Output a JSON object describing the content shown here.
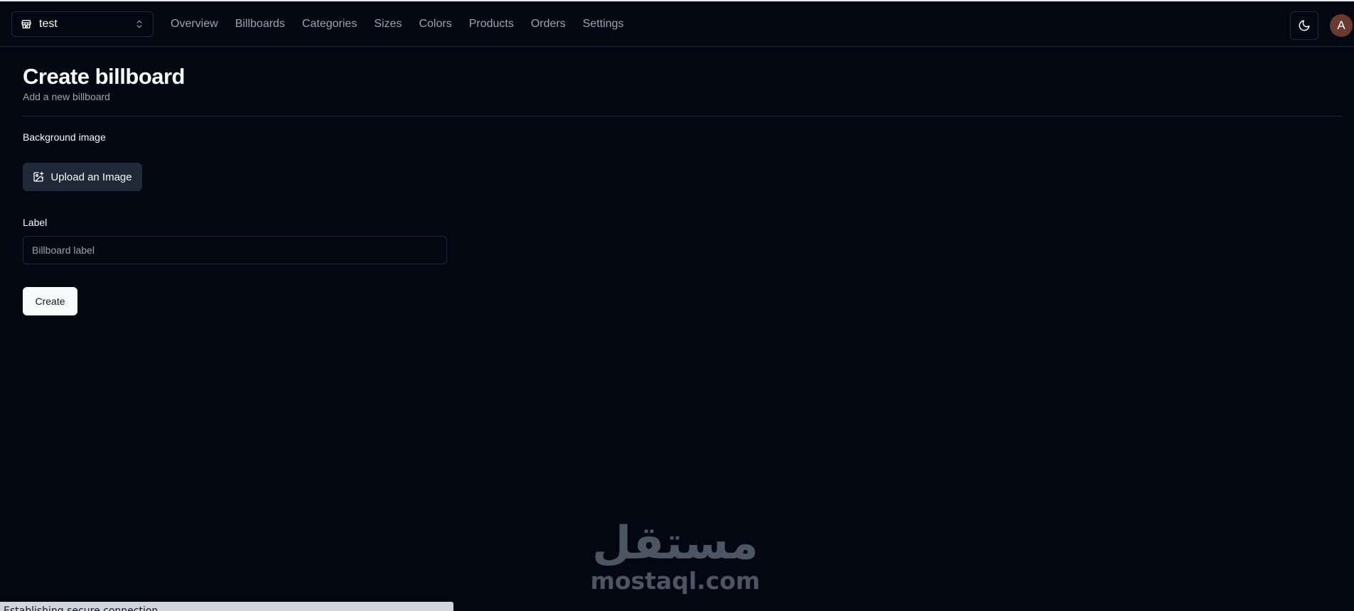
{
  "navbar": {
    "store_name": "test",
    "links": [
      "Overview",
      "Billboards",
      "Categories",
      "Sizes",
      "Colors",
      "Products",
      "Orders",
      "Settings"
    ],
    "avatar_initial": "A"
  },
  "page": {
    "title": "Create billboard",
    "subtitle": "Add a new billboard"
  },
  "form": {
    "background_label": "Background image",
    "upload_label": "Upload an Image",
    "label_label": "Label",
    "label_placeholder": "Billboard label",
    "label_value": "",
    "submit_label": "Create"
  },
  "watermark": {
    "arabic": "مستقل",
    "latin": "mostaql.com"
  },
  "status_bar": {
    "text": "Establishing secure connection..."
  },
  "colors": {
    "background": "#030712",
    "border": "#1f2937",
    "muted_text": "#9ca3af",
    "primary_button": "#f9fafb",
    "secondary_button": "#1f2937",
    "avatar": "#6b3a2e"
  }
}
